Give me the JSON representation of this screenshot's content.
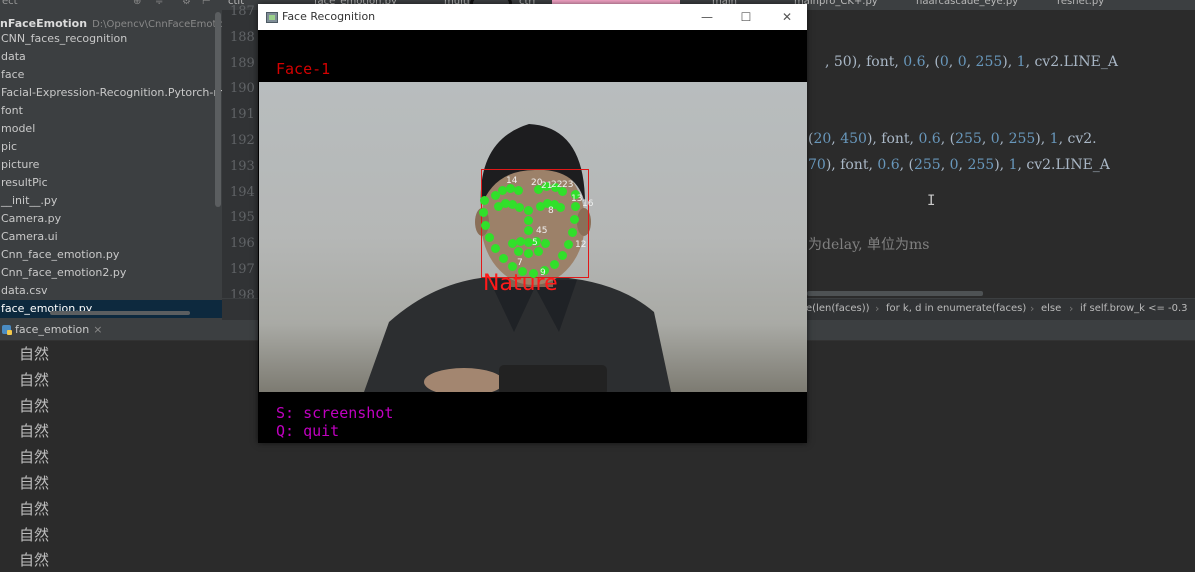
{
  "project": {
    "top_label": "ect",
    "root_name": "nFaceEmotion",
    "root_path": "D:\\Opencv\\CnnFaceEmotion",
    "items": [
      "CNN_faces_recognition",
      "data",
      "face",
      "Facial-Expression-Recognition.Pytorch-maste",
      "font",
      "model",
      "pic",
      "picture",
      "resultPic",
      "__init__.py",
      "Camera.py",
      "Camera.ui",
      "Cnn_face_emotion.py",
      "Cnn_face_emotion2.py",
      "data.csv",
      "face_emotion.py"
    ],
    "selected_index": 15
  },
  "editor": {
    "tabs": [
      "ctlt",
      "face_emotion.py",
      "multi",
      "ctrl",
      "",
      "main",
      "mainpro_CK+.py",
      "haarcascade_eye.py",
      "resnet.py"
    ],
    "line_numbers": [
      "187",
      "188",
      "189",
      "190",
      "191",
      "192",
      "193",
      "194",
      "195",
      "196",
      "197",
      "198"
    ],
    "code_lines": {
      "l189": [
        ", 50), font, ",
        "0.6",
        ", (",
        "0",
        ", ",
        "0",
        ", ",
        "255",
        "), ",
        "1",
        ", cv2.LINE_A"
      ],
      "l192": [
        "(",
        "20",
        ", ",
        "450",
        "), font, ",
        "0.6",
        ", (",
        "255",
        ", ",
        "0",
        ", ",
        "255",
        "), ",
        "1",
        ", cv2."
      ],
      "l193": [
        "70",
        "), font, ",
        "0.6",
        ", (",
        "255",
        ", ",
        "0",
        ", ",
        "255",
        "), ",
        "1",
        ", cv2.LINE_A"
      ],
      "l196": "为delay, 单位为ms"
    },
    "breadcrumbs": [
      "e(len(faces))",
      "for k, d in enumerate(faces)",
      "else",
      "if self.brow_k <= -0.3"
    ]
  },
  "run": {
    "tab_label": "face_emotion",
    "output_lines": [
      "自然",
      "自然",
      "自然",
      "自然",
      "自然",
      "自然",
      "自然",
      "自然",
      "自然"
    ]
  },
  "cv_window": {
    "title": "Face Recognition",
    "buttons": {
      "minimize": "—",
      "maximize": "☐",
      "close": "✕"
    },
    "face_count_label": "Face-1",
    "emotion_label": "Nature",
    "landmark_numbers": [
      "14",
      "20",
      "21",
      "22",
      "23",
      "13",
      "16",
      "8",
      "45",
      "12",
      "5",
      "7",
      "9"
    ],
    "help_lines": [
      "S: screenshot",
      "Q: quit"
    ],
    "colors": {
      "label_red": "#d40000",
      "help_magenta": "#c000c0",
      "landmark_green": "#31e02a",
      "box_red": "#e01818"
    }
  }
}
